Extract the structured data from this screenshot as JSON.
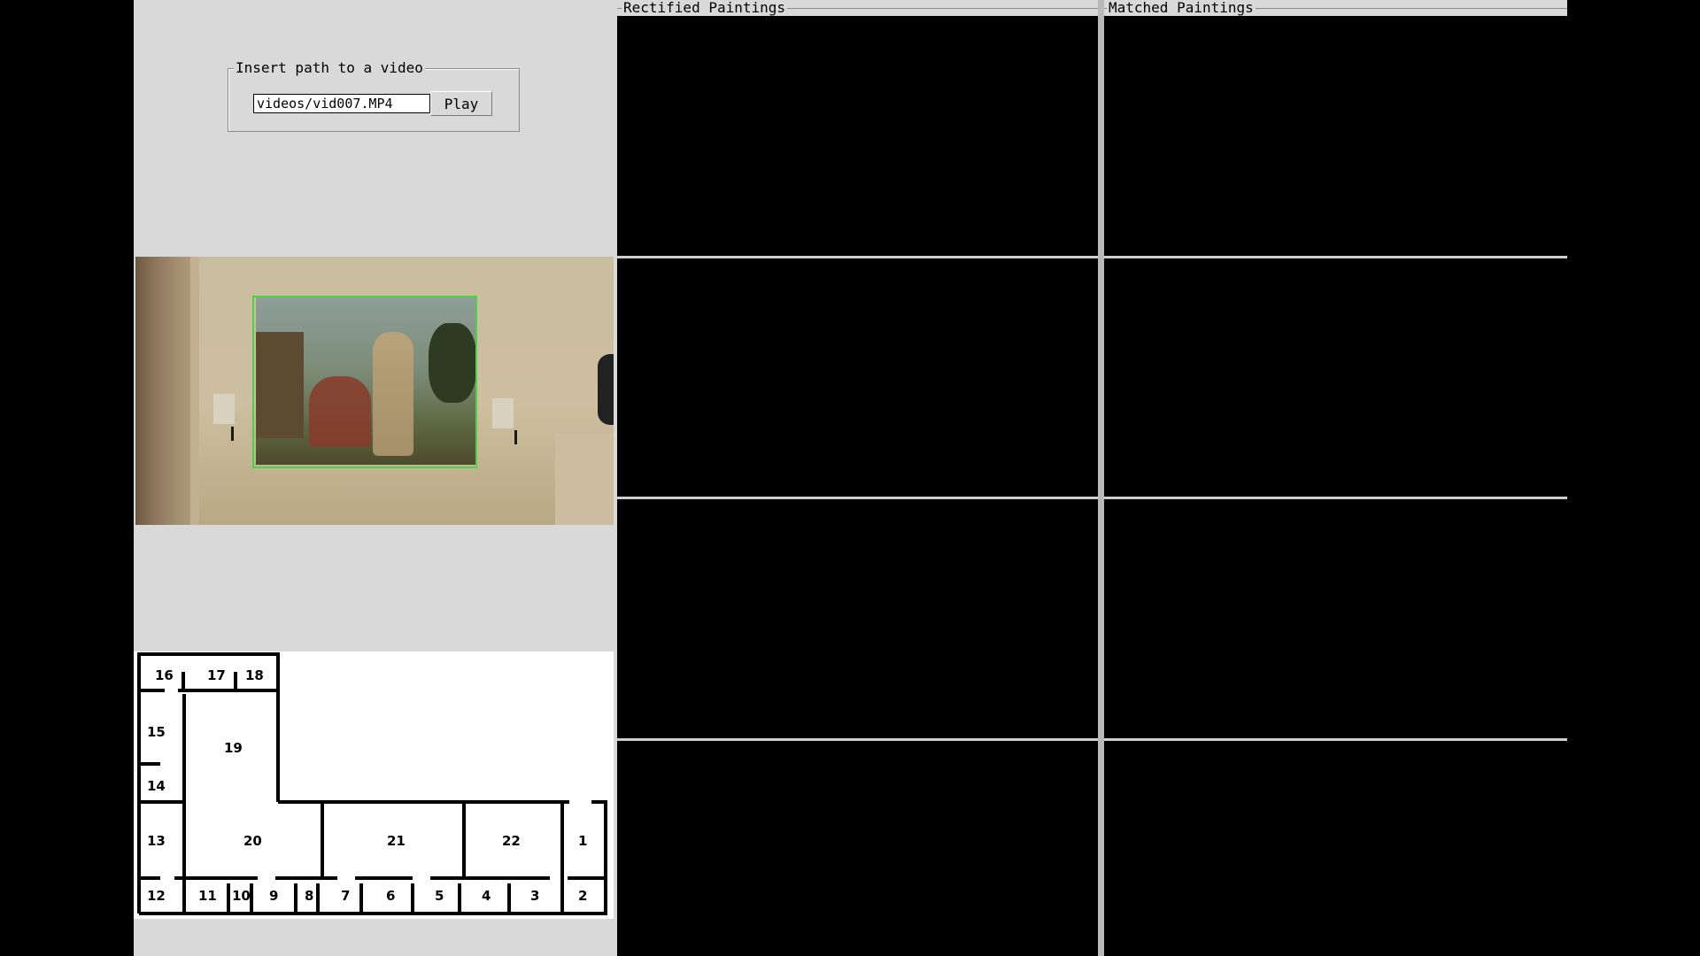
{
  "video_input": {
    "legend": "Insert path to a video",
    "path_value": "videos/vid007.MP4",
    "play_label": "Play"
  },
  "panels": {
    "rectified_title": "Rectified Paintings",
    "matched_title": "Matched Paintings"
  },
  "floor_map": {
    "rooms": [
      "16",
      "17",
      "18",
      "15",
      "19",
      "14",
      "13",
      "20",
      "21",
      "22",
      "1",
      "12",
      "11",
      "10",
      "9",
      "8",
      "7",
      "6",
      "5",
      "4",
      "3",
      "2"
    ]
  },
  "colors": {
    "panel_bg": "#d9d9d9",
    "detection_box": "#4bd14b",
    "slot_bg": "#000000"
  }
}
